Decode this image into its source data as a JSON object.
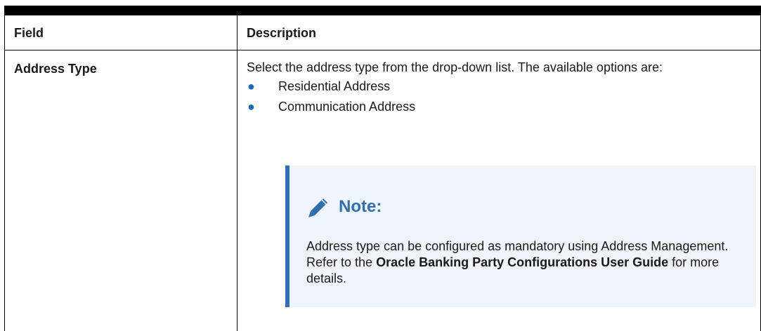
{
  "table": {
    "headers": {
      "field": "Field",
      "description": "Description"
    },
    "rows": [
      {
        "field": "Address Type",
        "description_intro": "Select the address type from the drop-down list. The available options are:",
        "options": [
          "Residential Address",
          "Communication Address"
        ],
        "note": {
          "title": "Note:",
          "icon": "pencil-icon",
          "text_before": "Address type can be configured as mandatory using Address Management. Refer to the ",
          "text_strong": "Oracle Banking Party Configurations User Guide",
          "text_after": " for more details."
        }
      }
    ]
  },
  "colors": {
    "accent": "#2f6fb0",
    "note_background": "#eef4fa",
    "bullet": "#1f6bb3"
  }
}
